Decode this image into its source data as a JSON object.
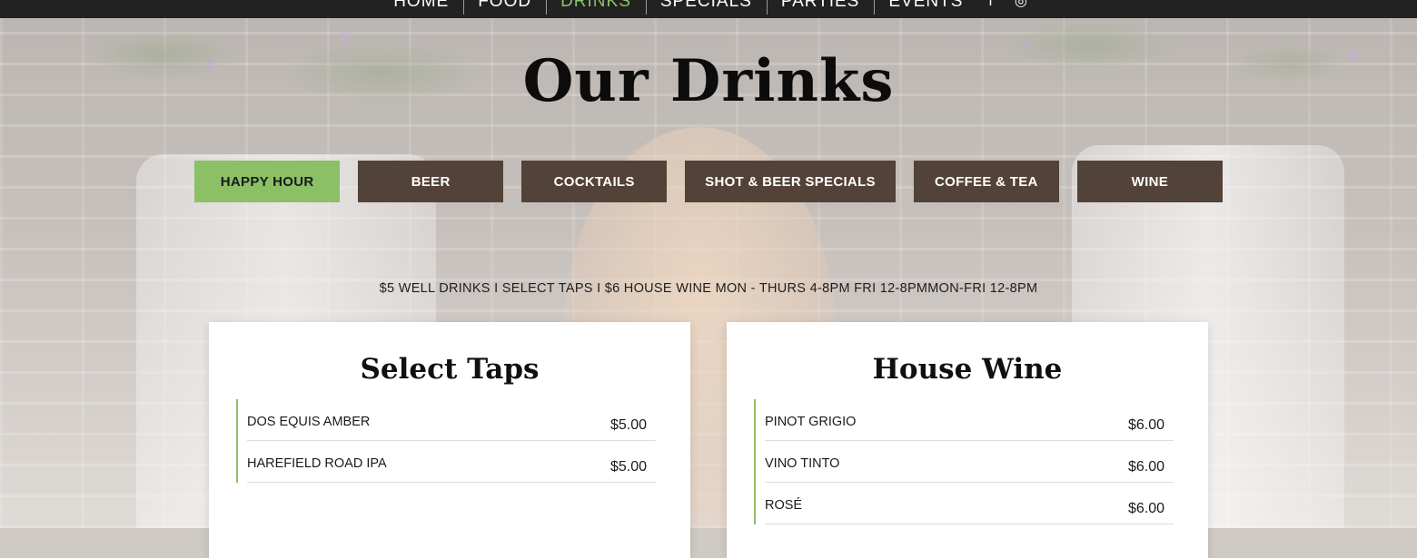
{
  "nav": {
    "items": [
      {
        "label": "HOME",
        "active": false
      },
      {
        "label": "FOOD",
        "active": false
      },
      {
        "label": "DRINKS",
        "active": true
      },
      {
        "label": "SPECIALS",
        "active": false
      },
      {
        "label": "PARTIES",
        "active": false
      },
      {
        "label": "EVENTS",
        "active": false
      }
    ],
    "social": [
      {
        "icon": "facebook-icon",
        "glyph": "f"
      },
      {
        "icon": "instagram-icon",
        "glyph": "◎"
      }
    ],
    "active_color": "#8cc067"
  },
  "page": {
    "title": "Our Drinks"
  },
  "tabs": [
    {
      "label": "HAPPY HOUR",
      "active": true
    },
    {
      "label": "BEER",
      "active": false
    },
    {
      "label": "COCKTAILS",
      "active": false
    },
    {
      "label": "SHOT & BEER SPECIALS",
      "active": false
    },
    {
      "label": "COFFEE & TEA",
      "active": false
    },
    {
      "label": "WINE",
      "active": false
    }
  ],
  "colors": {
    "tab_bg": "#524237",
    "tab_active_bg": "#8cc067",
    "accent": "#8cc067",
    "nav_bg": "#222222"
  },
  "promo": "$5 WELL DRINKS I SELECT TAPS I $6 HOUSE WINE MON - THURS 4-8PM FRI 12-8PMMON-FRI 12-8PM",
  "cards": [
    {
      "title": "Select Taps",
      "items": [
        {
          "name": "DOS EQUIS AMBER",
          "price": "$5.00"
        },
        {
          "name": "HAREFIELD ROAD IPA",
          "price": "$5.00"
        }
      ]
    },
    {
      "title": "House Wine",
      "items": [
        {
          "name": "PINOT GRIGIO",
          "price": "$6.00"
        },
        {
          "name": "VINO TINTO",
          "price": "$6.00"
        },
        {
          "name": "ROSÉ",
          "price": "$6.00"
        }
      ]
    }
  ]
}
